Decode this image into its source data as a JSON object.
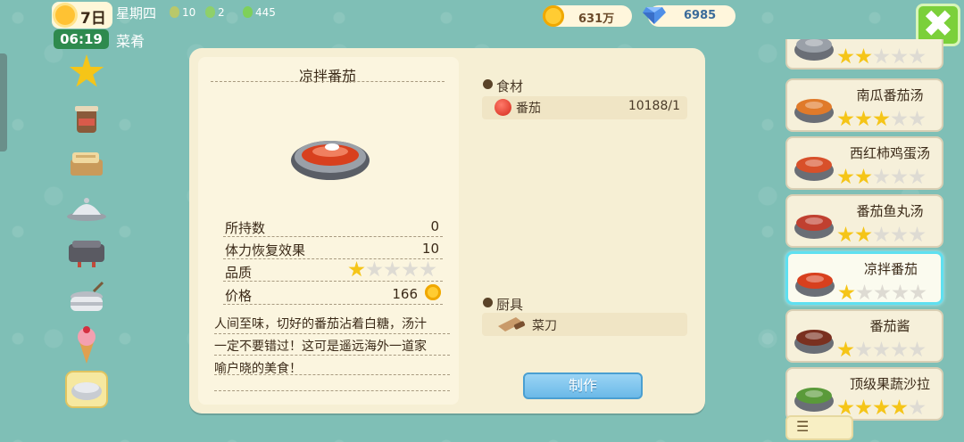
{
  "status": {
    "day": "7日",
    "time": "06:19",
    "weekday": "星期四",
    "stat1": "10",
    "stat2": "2",
    "stat3": "445",
    "category_title": "菜肴"
  },
  "currency": {
    "coins": "631万",
    "gems": "6985"
  },
  "close_label": "✖",
  "left_categories": [
    "star-icon",
    "drink-cup-icon",
    "bread-icon",
    "covered-dish-icon",
    "baking-tray-icon",
    "soup-pot-icon",
    "ice-cream-icon",
    "pot-icon"
  ],
  "detail": {
    "name": "凉拌番茄",
    "stats": [
      {
        "label": "所持数",
        "value": "0"
      },
      {
        "label": "体力恢复效果",
        "value": "10"
      },
      {
        "label": "品质",
        "value": ""
      },
      {
        "label": "价格",
        "value": "166"
      }
    ],
    "quality_stars": 1,
    "description_lines": [
      "人间至味，切好的番茄沾着白糖，汤汁",
      "一定不要错过！这可是遥远海外一道家",
      "喻户晓的美食！"
    ],
    "ingredients_title": "食材",
    "ingredient": {
      "name": "番茄",
      "count": "10188/1"
    },
    "tools_title": "厨具",
    "tool": {
      "name": "菜刀"
    },
    "make_label": "制作"
  },
  "recipes": [
    {
      "name": "",
      "stars": 2,
      "selected": false
    },
    {
      "name": "南瓜番茄汤",
      "stars": 3,
      "selected": false
    },
    {
      "name": "西红柿鸡蛋汤",
      "stars": 2,
      "selected": false
    },
    {
      "name": "番茄鱼丸汤",
      "stars": 2,
      "selected": false
    },
    {
      "name": "凉拌番茄",
      "stars": 1,
      "selected": true
    },
    {
      "name": "番茄酱",
      "stars": 1,
      "selected": false
    },
    {
      "name": "顶级果蔬沙拉",
      "stars": 4,
      "selected": false
    }
  ],
  "list_button": "☰",
  "colors": {
    "accent_green": "#7bd03a",
    "star_gold": "#f5c518",
    "button_blue": "#6bb9e8"
  }
}
